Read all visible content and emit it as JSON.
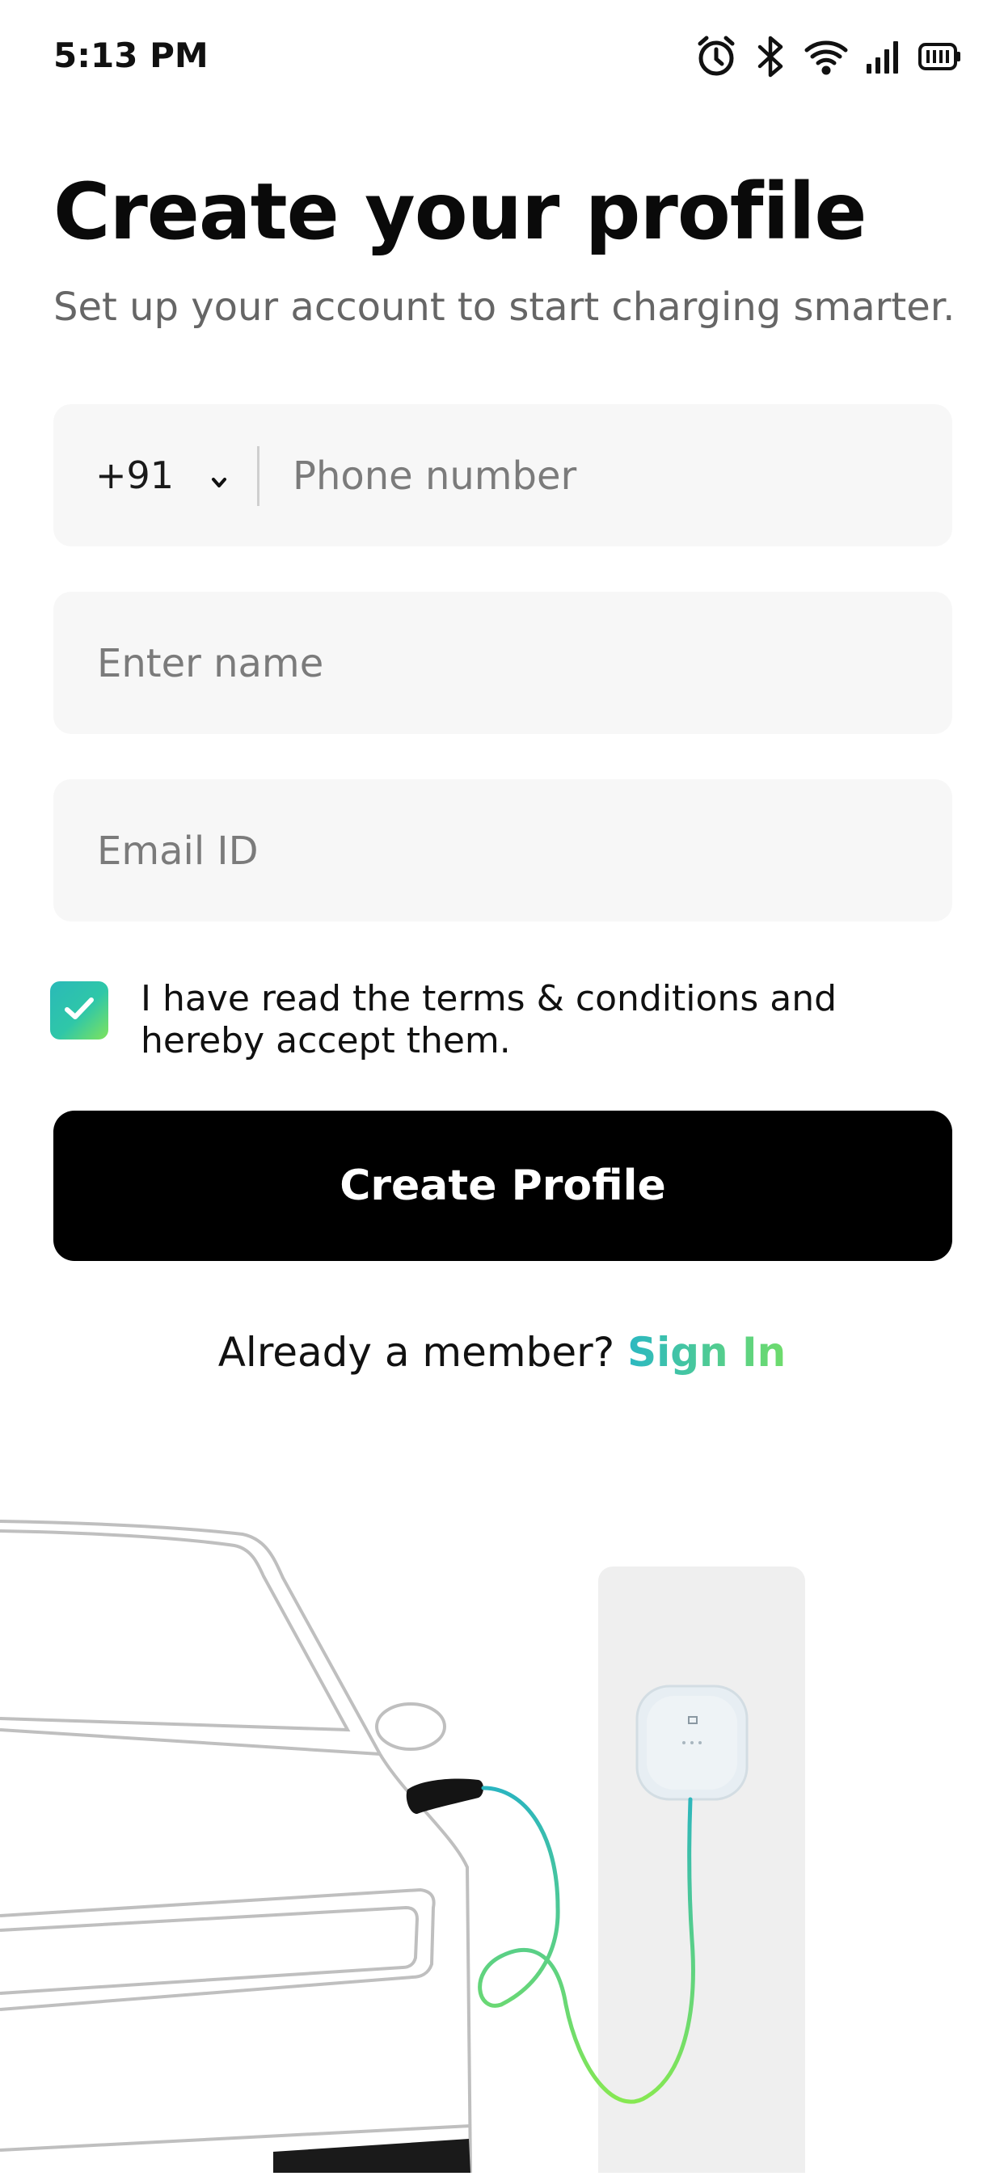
{
  "status_bar": {
    "time": "5:13 PM",
    "icons": [
      "alarm-icon",
      "bluetooth-icon",
      "wifi-icon",
      "signal-icon",
      "battery-icon"
    ]
  },
  "header": {
    "title": "Create your profile",
    "subtitle": "Set up your account to start charging smarter."
  },
  "form": {
    "country_code": "+91",
    "phone_placeholder": "Phone number",
    "name_placeholder": "Enter name",
    "email_placeholder": "Email ID",
    "terms_checked": true,
    "terms_text": "I have read the terms & conditions and hereby accept them.",
    "submit_label": "Create Profile"
  },
  "footer": {
    "prompt": "Already a member?",
    "signin_label": "Sign In"
  },
  "colors": {
    "accent_start": "#2bb8c2",
    "accent_end": "#6fdc6b",
    "button_bg": "#000000",
    "field_bg": "#f7f7f7"
  }
}
